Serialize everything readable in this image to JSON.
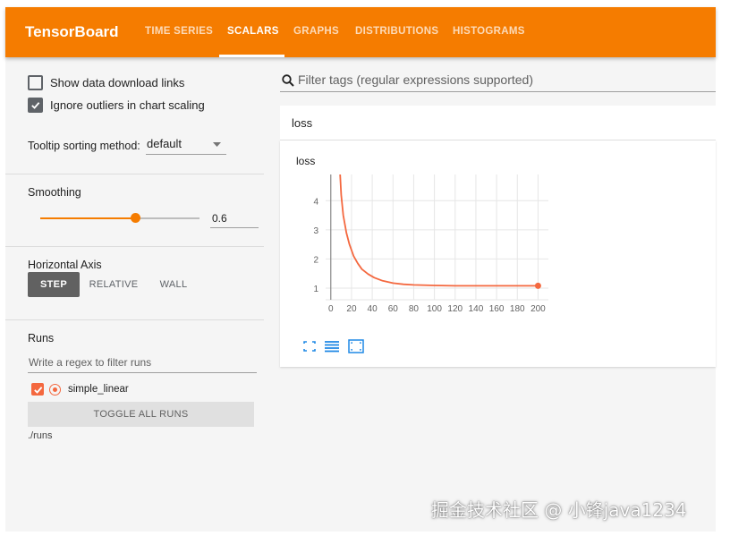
{
  "topbar": {
    "brand": "TensorBoard",
    "tabs": [
      {
        "label": "TIME SERIES",
        "active": false
      },
      {
        "label": "SCALARS",
        "active": true
      },
      {
        "label": "GRAPHS",
        "active": false
      },
      {
        "label": "DISTRIBUTIONS",
        "active": false
      },
      {
        "label": "HISTOGRAMS",
        "active": false
      }
    ],
    "color": "#f57c00"
  },
  "sidebar": {
    "show_download_links": {
      "label": "Show data download links",
      "checked": false
    },
    "ignore_outliers": {
      "label": "Ignore outliers in chart scaling",
      "checked": true
    },
    "tooltip_sorting": {
      "label": "Tooltip sorting method:",
      "value": "default"
    },
    "smoothing": {
      "label": "Smoothing",
      "value": "0.6",
      "level": 0.6
    },
    "horizontal_axis": {
      "label": "Horizontal Axis",
      "options": [
        "STEP",
        "RELATIVE",
        "WALL"
      ],
      "selected": "STEP"
    },
    "runs": {
      "label": "Runs",
      "filter_placeholder": "Write a regex to filter runs",
      "items": [
        {
          "name": "simple_linear",
          "checked": true,
          "color": "#f4683f"
        }
      ],
      "toggle_label": "TOGGLE ALL RUNS",
      "directory": "./runs"
    }
  },
  "main": {
    "filter_placeholder": "Filter tags (regular expressions supported)",
    "search_icon": "search-icon",
    "card_header": "loss",
    "card_controls": [
      "fullscreen-icon",
      "list-icon",
      "fit-domain-icon"
    ]
  },
  "chart_data": {
    "type": "line",
    "title": "loss",
    "xlabel": "",
    "ylabel": "",
    "xlim": [
      -5,
      210
    ],
    "ylim": [
      0.6,
      4.9
    ],
    "x_ticks": [
      0,
      20,
      40,
      60,
      80,
      100,
      120,
      140,
      160,
      180,
      200
    ],
    "y_ticks": [
      1,
      2,
      3,
      4
    ],
    "grid": true,
    "series": [
      {
        "name": "simple_linear",
        "color": "#f4683f",
        "x": [
          9,
          10,
          12,
          15,
          18,
          22,
          26,
          30,
          36,
          42,
          50,
          60,
          70,
          80,
          100,
          120,
          140,
          160,
          180,
          200
        ],
        "y": [
          4.9,
          4.2,
          3.5,
          2.9,
          2.5,
          2.1,
          1.85,
          1.65,
          1.48,
          1.36,
          1.25,
          1.17,
          1.13,
          1.11,
          1.09,
          1.08,
          1.08,
          1.08,
          1.08,
          1.08
        ]
      }
    ],
    "end_point": {
      "x": 200,
      "y": 1.08
    }
  },
  "watermark": "掘金技术社区 @ 小锋java1234"
}
